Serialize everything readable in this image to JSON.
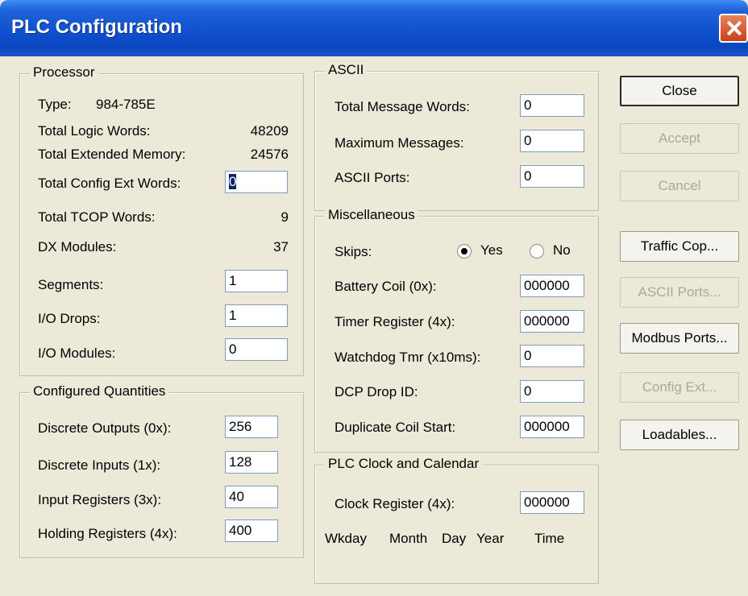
{
  "window": {
    "title": "PLC Configuration"
  },
  "processor": {
    "legend": "Processor",
    "type_label": "Type:",
    "type_value": "984-785E",
    "logic_words_label": "Total Logic Words:",
    "logic_words_value": "48209",
    "ext_memory_label": "Total Extended Memory:",
    "ext_memory_value": "24576",
    "config_ext_label": "Total Config Ext Words:",
    "config_ext_value": "0",
    "tcop_label": "Total TCOP Words:",
    "tcop_value": "9",
    "dx_label": "DX Modules:",
    "dx_value": "37",
    "segments_label": "Segments:",
    "segments_value": "1",
    "io_drops_label": "I/O Drops:",
    "io_drops_value": "1",
    "io_modules_label": "I/O Modules:",
    "io_modules_value": "0"
  },
  "quantities": {
    "legend": "Configured Quantities",
    "discrete_outputs_label": "Discrete Outputs (0x):",
    "discrete_outputs_value": "256",
    "discrete_inputs_label": "Discrete Inputs (1x):",
    "discrete_inputs_value": "128",
    "input_registers_label": "Input Registers (3x):",
    "input_registers_value": "40",
    "holding_registers_label": "Holding Registers  (4x):",
    "holding_registers_value": "400"
  },
  "ascii": {
    "legend": "ASCII",
    "message_words_label": "Total Message Words:",
    "message_words_value": "0",
    "max_messages_label": "Maximum Messages:",
    "max_messages_value": "0",
    "ports_label": "ASCII Ports:",
    "ports_value": "0"
  },
  "misc": {
    "legend": "Miscellaneous",
    "skips_label": "Skips:",
    "skips_yes": "Yes",
    "skips_no": "No",
    "skips_selected": "Yes",
    "battery_label": "Battery Coil (0x):",
    "battery_value": "000000",
    "timer_label": "Timer Register (4x):",
    "timer_value": "000000",
    "watchdog_label": "Watchdog Tmr (x10ms):",
    "watchdog_value": "0",
    "dcp_label": "DCP Drop ID:",
    "dcp_value": "0",
    "dup_coil_label": "Duplicate Coil Start:",
    "dup_coil_value": "000000"
  },
  "clock": {
    "legend": "PLC Clock and Calendar",
    "register_label": "Clock Register (4x):",
    "register_value": "000000",
    "wkday": "Wkday",
    "month": "Month",
    "day": "Day",
    "year": "Year",
    "time": "Time"
  },
  "buttons": {
    "close": "Close",
    "accept": "Accept",
    "cancel": "Cancel",
    "traffic_cop": "Traffic Cop...",
    "ascii_ports": "ASCII Ports...",
    "modbus_ports": "Modbus Ports...",
    "config_ext": "Config Ext...",
    "loadables": "Loadables..."
  }
}
